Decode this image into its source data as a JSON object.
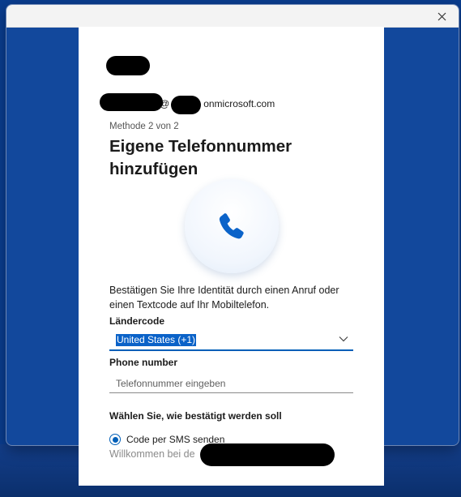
{
  "window": {
    "close_icon": "close-icon"
  },
  "account": {
    "email_suffix": "@",
    "email_domain": "onmicrosoft.com"
  },
  "page": {
    "method_step": "Methode 2 von 2",
    "title": "Eigene Telefonnummer hinzufügen",
    "phone_icon": "phone-icon",
    "description": "Bestätigen Sie Ihre Identität durch einen Anruf oder einen Textcode auf Ihr Mobiltelefon."
  },
  "form": {
    "country_label": "Ländercode",
    "country_value": "United States (+1)",
    "phone_label": "Phone number",
    "phone_placeholder": "Telefonnummer eingeben",
    "phone_value": "",
    "verify_heading": "Wählen Sie, wie bestätigt werden soll",
    "sms_option": "Code per SMS senden"
  },
  "footer": {
    "welcome_text": "Willkommen bei de"
  },
  "colors": {
    "accent": "#005fb8",
    "background": "#0a3d8f",
    "selection": "#0a62c8"
  }
}
